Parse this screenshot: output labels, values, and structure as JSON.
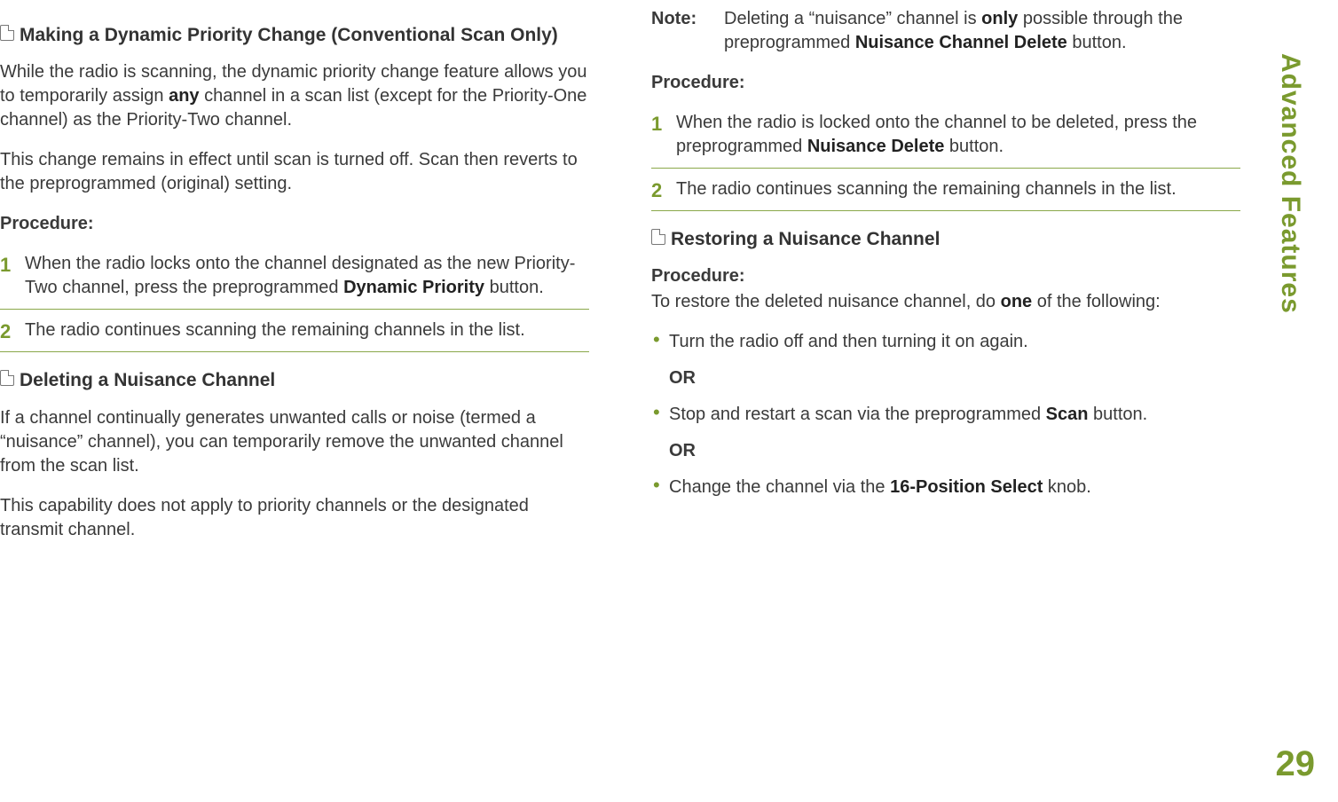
{
  "side_title": "Advanced Features",
  "page_number": "29",
  "col1": {
    "sec1": {
      "heading": "Making a Dynamic Priority Change (Conventional Scan Only)",
      "p1a": "While the radio is scanning, the dynamic priority change feature allows you to temporarily assign ",
      "p1b_bold": "any",
      "p1c": " channel in a scan list (except for the Priority-One channel) as the Priority-Two channel.",
      "p2": "This change remains in effect until scan is turned off. Scan then reverts to the preprogrammed (original) setting.",
      "proc_label": "Procedure:",
      "step1a": "When the radio locks onto the channel designated as the new Priority-Two channel, press the preprogrammed ",
      "step1b_bold": "Dynamic Priority",
      "step1c": " button.",
      "step2": "The radio continues scanning the remaining channels in the list."
    },
    "sec2": {
      "heading": "Deleting a Nuisance Channel",
      "p1": "If a channel continually generates unwanted calls or noise (termed a “nuisance” channel), you can temporarily remove the unwanted channel from the scan list.",
      "p2": "This capability does not apply to priority channels or the designated transmit channel."
    }
  },
  "col2": {
    "note": {
      "label": "Note:",
      "a": "Deleting a “nuisance” channel is ",
      "b_bold": "only",
      "c": " possible through the preprogrammed ",
      "d_bold": "Nuisance Channel Delete",
      "e": " button."
    },
    "proc_label": "Procedure:",
    "step1a": "When the radio is locked onto the channel to be deleted, press the preprogrammed ",
    "step1b_bold": "Nuisance Delete",
    "step1c": " button.",
    "step2": "The radio continues scanning the remaining channels in the list.",
    "sec3": {
      "heading": "Restoring a Nuisance Channel",
      "proc_label": "Procedure:",
      "intro_a": "To restore the deleted nuisance channel, do ",
      "intro_b_bold": "one",
      "intro_c": " of the following:",
      "b1": "Turn the radio off and then turning it on again.",
      "or": "OR",
      "b2a": "Stop and restart a scan via the preprogrammed ",
      "b2b_bold": "Scan",
      "b2c": " button.",
      "b3a": "Change the channel via the ",
      "b3b_bold": "16-Position Select",
      "b3c": " knob."
    }
  }
}
